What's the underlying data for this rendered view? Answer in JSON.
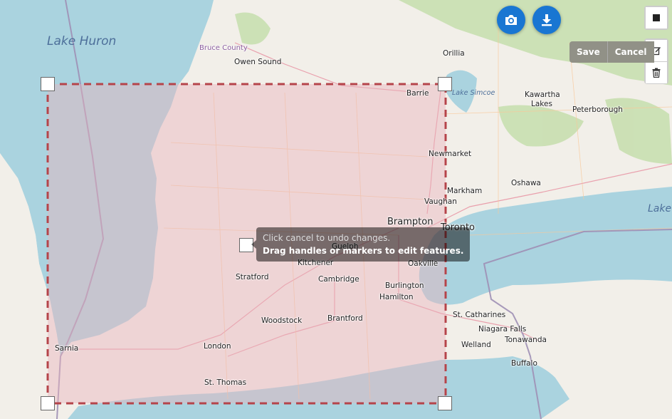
{
  "map": {
    "labels": {
      "lake_huron": "Lake Huron",
      "bruce_county": "Bruce County",
      "owen_sound": "Owen Sound",
      "orillia": "Orillia",
      "barrie": "Barrie",
      "lake_simcoe": "Lake Simcoe",
      "kawartha_lakes_1": "Kawartha",
      "kawartha_lakes_2": "Lakes",
      "peterborough": "Peterborough",
      "newmarket": "Newmarket",
      "markham": "Markham",
      "oshawa": "Oshawa",
      "vaughan": "Vaughan",
      "brampton": "Brampton",
      "toronto": "Toronto",
      "lake_east": "Lake",
      "guelph": "Guelph",
      "kitchener": "Kitchener",
      "oakville": "Oakville",
      "stratford": "Stratford",
      "cambridge": "Cambridge",
      "burlington": "Burlington",
      "hamilton": "Hamilton",
      "st_catharines": "St. Catharines",
      "niagara_falls": "Niagara Falls",
      "woodstock": "Woodstock",
      "brantford": "Brantford",
      "welland": "Welland",
      "tonawanda": "Tonawanda",
      "sarnia": "Sarnia",
      "london": "London",
      "buffalo": "Buffalo",
      "st_thomas": "St. Thomas"
    },
    "colors": {
      "water": "#aad3df",
      "land": "#f2efe9",
      "forest": "#c8dfb0",
      "rectangle_stroke": "#b5444a",
      "rectangle_fill": "#e8b4bd",
      "button_blue": "#1976d2"
    }
  },
  "controls": {
    "camera_icon": "camera-icon",
    "download_icon": "download-icon",
    "draw_rectangle_icon": "square-icon",
    "edit_icon": "edit-icon",
    "delete_icon": "trash-icon",
    "save_label": "Save",
    "cancel_label": "Cancel"
  },
  "tooltip": {
    "subtext": "Click cancel to undo changes.",
    "text": "Drag handles or markers to edit features."
  }
}
